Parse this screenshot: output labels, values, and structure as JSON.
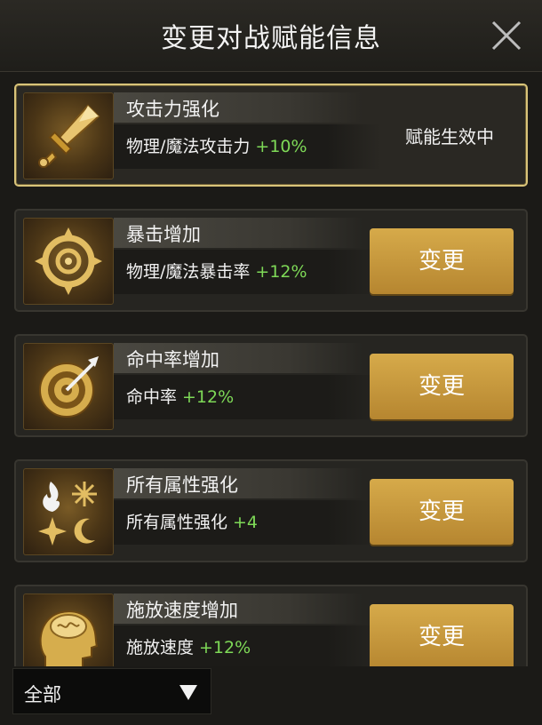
{
  "header": {
    "title": "变更对战赋能信息",
    "close_icon": "close-icon"
  },
  "colors": {
    "accent_gold": "#c99a3d",
    "value_green": "#7ed957",
    "active_border": "#d9c47a"
  },
  "cards": [
    {
      "name": "攻击力强化",
      "desc": "物理/魔法攻击力",
      "value": "+10%",
      "icon": "sword-icon",
      "status": "赋能生效中"
    },
    {
      "name": "暴击增加",
      "desc": "物理/魔法暴击率",
      "value": "+12%",
      "icon": "crosshair-icon",
      "button": "变更"
    },
    {
      "name": "命中率增加",
      "desc": "命中率",
      "value": "+12%",
      "icon": "target-icon",
      "button": "变更"
    },
    {
      "name": "所有属性强化",
      "desc": "所有属性强化",
      "value": "+4",
      "icon": "elements-icon",
      "button": "变更"
    },
    {
      "name": "施放速度增加",
      "desc": "施放速度",
      "value": "+12%",
      "icon": "brain-head-icon",
      "button": "变更"
    }
  ],
  "filter": {
    "label": "全部",
    "arrow_icon": "triangle-down-icon"
  }
}
